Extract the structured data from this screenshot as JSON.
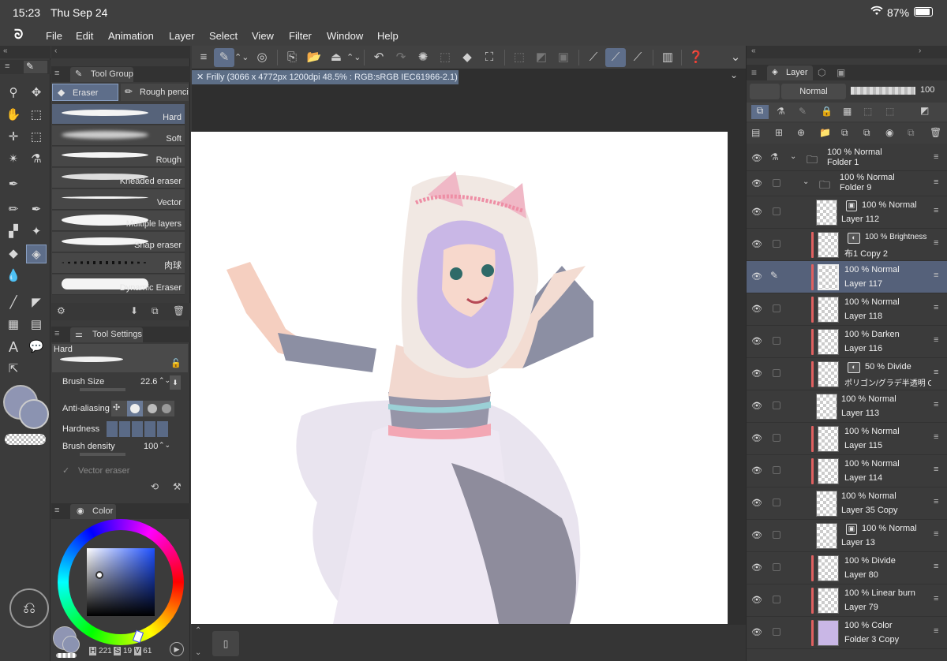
{
  "status": {
    "time": "15:23",
    "date": "Thu Sep 24",
    "battery": "87%"
  },
  "menu": {
    "items": [
      "File",
      "Edit",
      "Animation",
      "Layer",
      "Select",
      "View",
      "Filter",
      "Window",
      "Help"
    ]
  },
  "document": {
    "tab": "Frilly (3066 x 4772px 1200dpi 48.5% : RGB:sRGB IEC61966-2.1)"
  },
  "tool_panel": {
    "group_title": "Tool Group",
    "tabs": [
      "Eraser",
      "Rough penci"
    ],
    "brushes": [
      "Hard",
      "Soft",
      "Rough",
      "Kneaded eraser",
      "Vector",
      "Multiple layers",
      "Snap eraser",
      "肉球",
      "Dynamic Eraser"
    ],
    "settings_title": "Tool Settings",
    "preset": "Hard",
    "brush_size_label": "Brush Size",
    "brush_size": "22.6",
    "anti_alias_label": "Anti-aliasing",
    "hardness_label": "Hardness",
    "density_label": "Brush density",
    "density": "100",
    "vector_eraser_label": "Vector eraser"
  },
  "color_panel": {
    "title": "Color",
    "h_label": "H",
    "h": "221",
    "s_label": "S",
    "s": "19",
    "v_label": "V",
    "v": "61",
    "main_color": "#8f95b3",
    "sub_color": "#8b93b1"
  },
  "layer_panel": {
    "title": "Layer",
    "blend_mode": "Normal",
    "opacity": "100",
    "layers": [
      {
        "mode": "100 % Normal",
        "name": "Folder 1"
      },
      {
        "mode": "100 % Normal",
        "name": "Folder 9"
      },
      {
        "mode": "100 % Normal",
        "name": "Layer 112"
      },
      {
        "mode": "100 % Brightness",
        "name": "布1 Copy 2"
      },
      {
        "mode": "100 % Normal",
        "name": "Layer 117"
      },
      {
        "mode": "100 % Normal",
        "name": "Layer 118"
      },
      {
        "mode": "100 % Darken",
        "name": "Layer 116"
      },
      {
        "mode": "50 % Divide",
        "name": "ポリゴン/グラデ半透明 Copy"
      },
      {
        "mode": "100 % Normal",
        "name": "Layer 113"
      },
      {
        "mode": "100 % Normal",
        "name": "Layer 115"
      },
      {
        "mode": "100 % Normal",
        "name": "Layer 114"
      },
      {
        "mode": "100 % Normal",
        "name": "Layer 35 Copy"
      },
      {
        "mode": "100 % Normal",
        "name": "Layer 13"
      },
      {
        "mode": "100 % Divide",
        "name": "Layer 80"
      },
      {
        "mode": "100 % Linear burn",
        "name": "Layer 79"
      },
      {
        "mode": "100 % Color",
        "name": "Folder 3 Copy"
      }
    ]
  }
}
